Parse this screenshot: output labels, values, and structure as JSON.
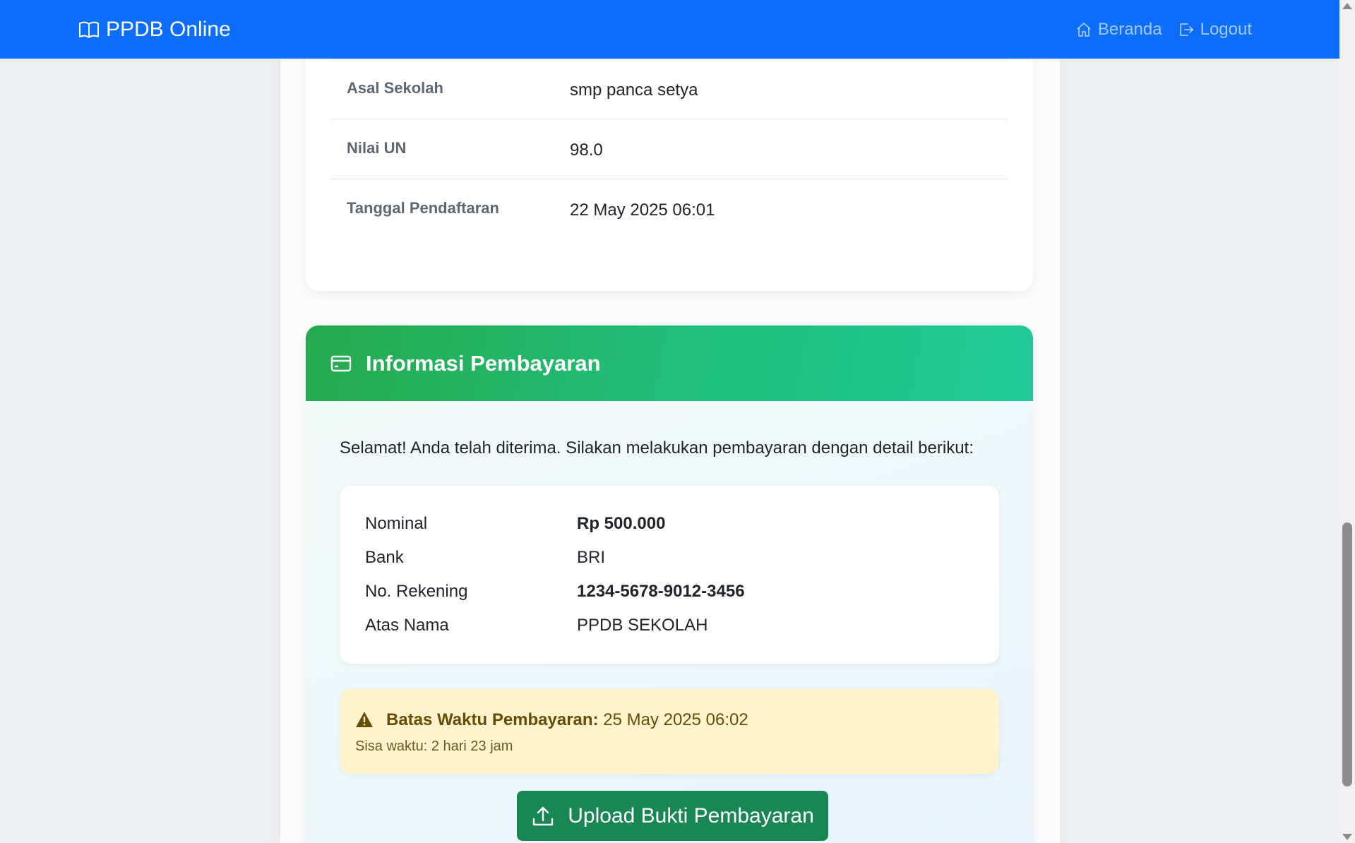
{
  "navbar": {
    "brand": "PPDB Online",
    "links": [
      {
        "label": "Beranda",
        "icon": "house-icon"
      },
      {
        "label": "Logout",
        "icon": "logout-icon"
      }
    ],
    "color": "#0d6efd"
  },
  "details": {
    "rows": [
      {
        "label": "Asal Sekolah",
        "value": "smp panca setya"
      },
      {
        "label": "Nilai UN",
        "value": "98.0"
      },
      {
        "label": "Tanggal Pendaftaran",
        "value": "22 May 2025 06:01"
      }
    ]
  },
  "payment": {
    "title": "Informasi Pembayaran",
    "icon": "credit-card-icon",
    "intro": "Selamat! Anda telah diterima. Silakan melakukan pembayaran dengan detail berikut:",
    "rows": [
      {
        "label": "Nominal",
        "value": "Rp 500.000"
      },
      {
        "label": "Bank",
        "value": "BRI"
      },
      {
        "label": "No. Rekening",
        "value": "1234-5678-9012-3456"
      },
      {
        "label": "Atas Nama",
        "value": "PPDB SEKOLAH"
      }
    ],
    "deadline": {
      "label": "Batas Waktu Pembayaran:",
      "value": "25 May 2025 06:02",
      "remaining": "Sisa waktu: 2 hari 23 jam",
      "icon": "warning-triangle-icon"
    },
    "upload_button": "Upload Bukti Pembayaran",
    "header_color": "#26a94e",
    "button_color": "#198754"
  }
}
